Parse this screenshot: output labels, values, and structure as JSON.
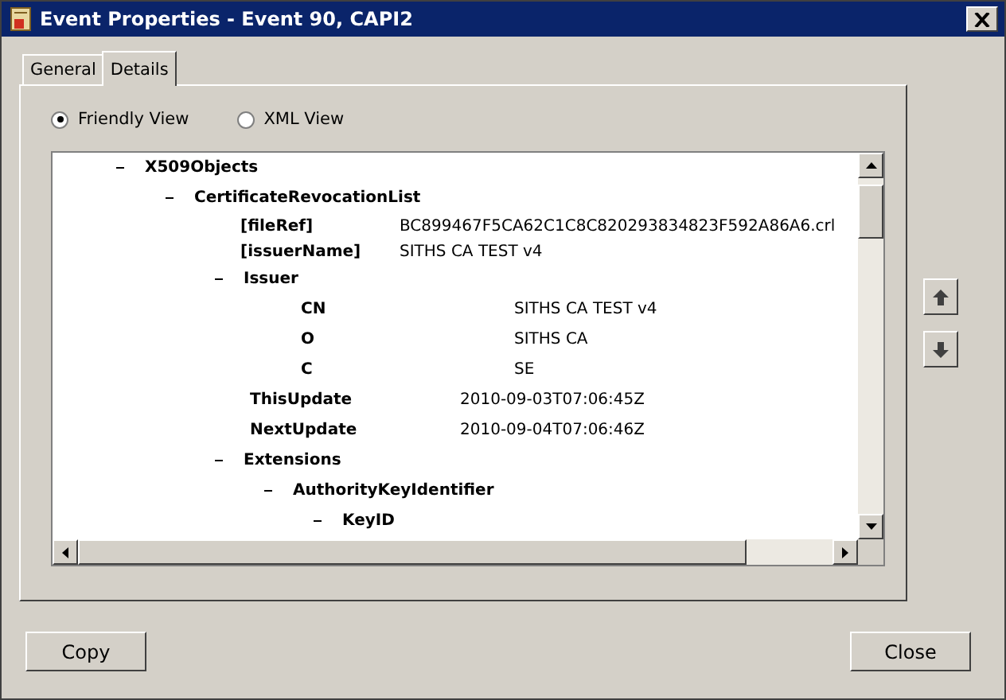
{
  "window": {
    "title": "Event Properties - Event 90, CAPI2"
  },
  "tabs": [
    {
      "label": "General",
      "selected": false
    },
    {
      "label": "Details",
      "selected": true
    }
  ],
  "views": [
    {
      "label": "Friendly View",
      "selected": true
    },
    {
      "label": "XML View",
      "selected": false
    }
  ],
  "tree": [
    {
      "kind": "node",
      "label": "X509Objects",
      "children": [
        {
          "kind": "node",
          "label": "CertificateRevocationList",
          "children": [
            {
              "kind": "attr",
              "label": "[fileRef]",
              "value": "BC899467F5CA62C1C8C820293834823F592A86A6.crl"
            },
            {
              "kind": "attr",
              "label": "[issuerName]",
              "value": "SITHS CA TEST v4"
            },
            {
              "kind": "node",
              "label": "Issuer",
              "children": [
                {
                  "kind": "field",
                  "label": "CN",
                  "value": "SITHS CA TEST v4"
                },
                {
                  "kind": "field",
                  "label": "O",
                  "value": "SITHS CA"
                },
                {
                  "kind": "field",
                  "label": "C",
                  "value": "SE"
                }
              ]
            },
            {
              "kind": "field",
              "label": "ThisUpdate",
              "value": "2010-09-03T07:06:45Z"
            },
            {
              "kind": "field",
              "label": "NextUpdate",
              "value": "2010-09-04T07:06:46Z"
            },
            {
              "kind": "node",
              "label": "Extensions",
              "children": [
                {
                  "kind": "node",
                  "label": "AuthorityKeyIdentifier",
                  "children": [
                    {
                      "kind": "node",
                      "label": "KeyID"
                    }
                  ]
                }
              ]
            }
          ]
        }
      ]
    }
  ],
  "buttons": [
    {
      "label": "Copy"
    },
    {
      "label": "Close"
    }
  ]
}
